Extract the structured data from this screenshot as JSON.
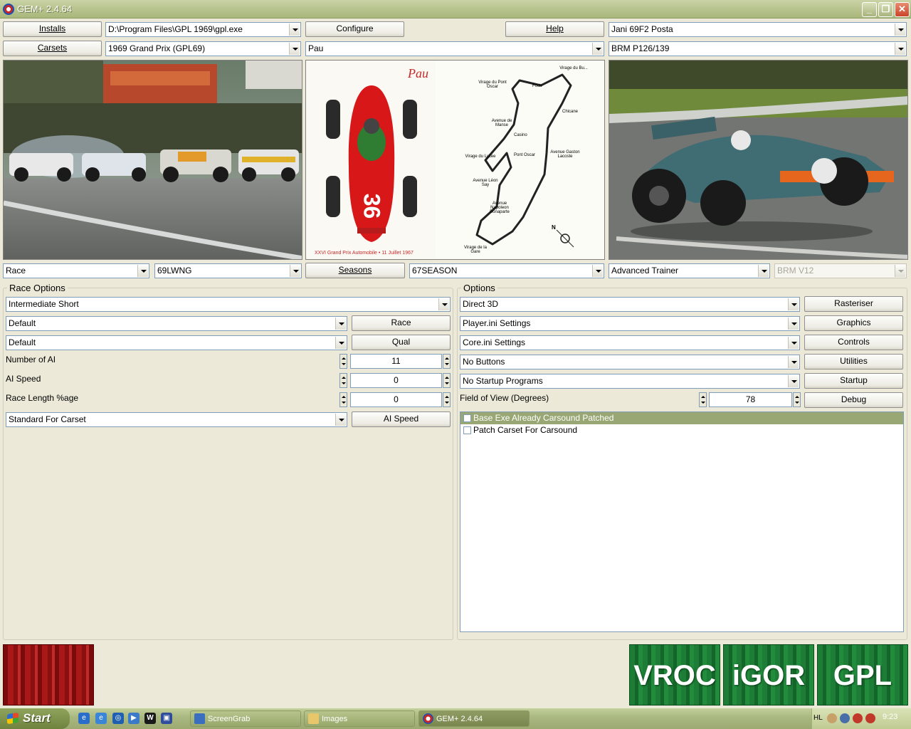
{
  "window": {
    "title": "GEM+ 2.4.64",
    "controls": {
      "minimize": "_",
      "restore": "❐",
      "close": "✕"
    }
  },
  "toolbar": {
    "installs_label": "Installs",
    "install_path": "D:\\Program Files\\GPL 1969\\gpl.exe",
    "configure_label": "Configure",
    "help_label": "Help",
    "driver": "Jani 69F2 Posta",
    "carsets_label": "Carsets",
    "carset": "1969 Grand Prix (GPL69)",
    "track": "Pau",
    "car": "BRM P126/139"
  },
  "track_map": {
    "title": "Pau",
    "car_number": "36",
    "caption": "XXVI Grand Prix Automobile  •  11 Juillet 1967",
    "north": "N",
    "corners": [
      "Virage du Bu...",
      "Virage du Pont Oscar",
      "Foch",
      "Chicane",
      "Avenue de Manse",
      "Casino",
      "Virage du Lycee",
      "Pont Oscar",
      "Avenue Gaston Lacoste",
      "Avenue Léon Say",
      "Avenue Napoleon Bonaparte",
      "Virage de la Gare"
    ]
  },
  "selectors": {
    "session_type": "Race",
    "setup": "69LWNG",
    "seasons_label": "Seasons",
    "season": "67SEASON",
    "difficulty": "Advanced Trainer",
    "engine": "BRM V12"
  },
  "race_options": {
    "title": "Race Options",
    "race_length": "Intermediate Short",
    "race_setting": "Default",
    "race_button": "Race",
    "qual_setting": "Default",
    "qual_button": "Qual",
    "num_ai_label": "Number of AI",
    "num_ai_value": "11",
    "ai_speed_label": "AI Speed",
    "ai_speed_value": "0",
    "race_length_pct_label": "Race Length %age",
    "race_length_pct_value": "0",
    "ai_speed_preset": "Standard For Carset",
    "ai_speed_button": "AI Speed"
  },
  "options": {
    "title": "Options",
    "renderer": "Direct 3D",
    "rasteriser_button": "Rasteriser",
    "player_ini": "Player.ini Settings",
    "graphics_button": "Graphics",
    "core_ini": "Core.ini Settings",
    "controls_button": "Controls",
    "buttons": "No Buttons",
    "utilities_button": "Utilities",
    "startup_programs": "No Startup Programs",
    "startup_button": "Startup",
    "fov_label": "Field of View (Degrees)",
    "fov_value": "78",
    "debug_button": "Debug",
    "checks": [
      {
        "label": "Base Exe Already Carsound Patched",
        "checked": false
      },
      {
        "label": "Patch Carset For Carsound",
        "checked": false
      }
    ]
  },
  "launchers": {
    "vroc": "VROC",
    "igor": "iGOR",
    "gpl": "GPL"
  },
  "taskbar": {
    "start_label": "Start",
    "tasks": [
      "ScreenGrab",
      "Images",
      "GEM+ 2.4.64"
    ],
    "tray_lang": "HL",
    "clock": "9:23"
  }
}
